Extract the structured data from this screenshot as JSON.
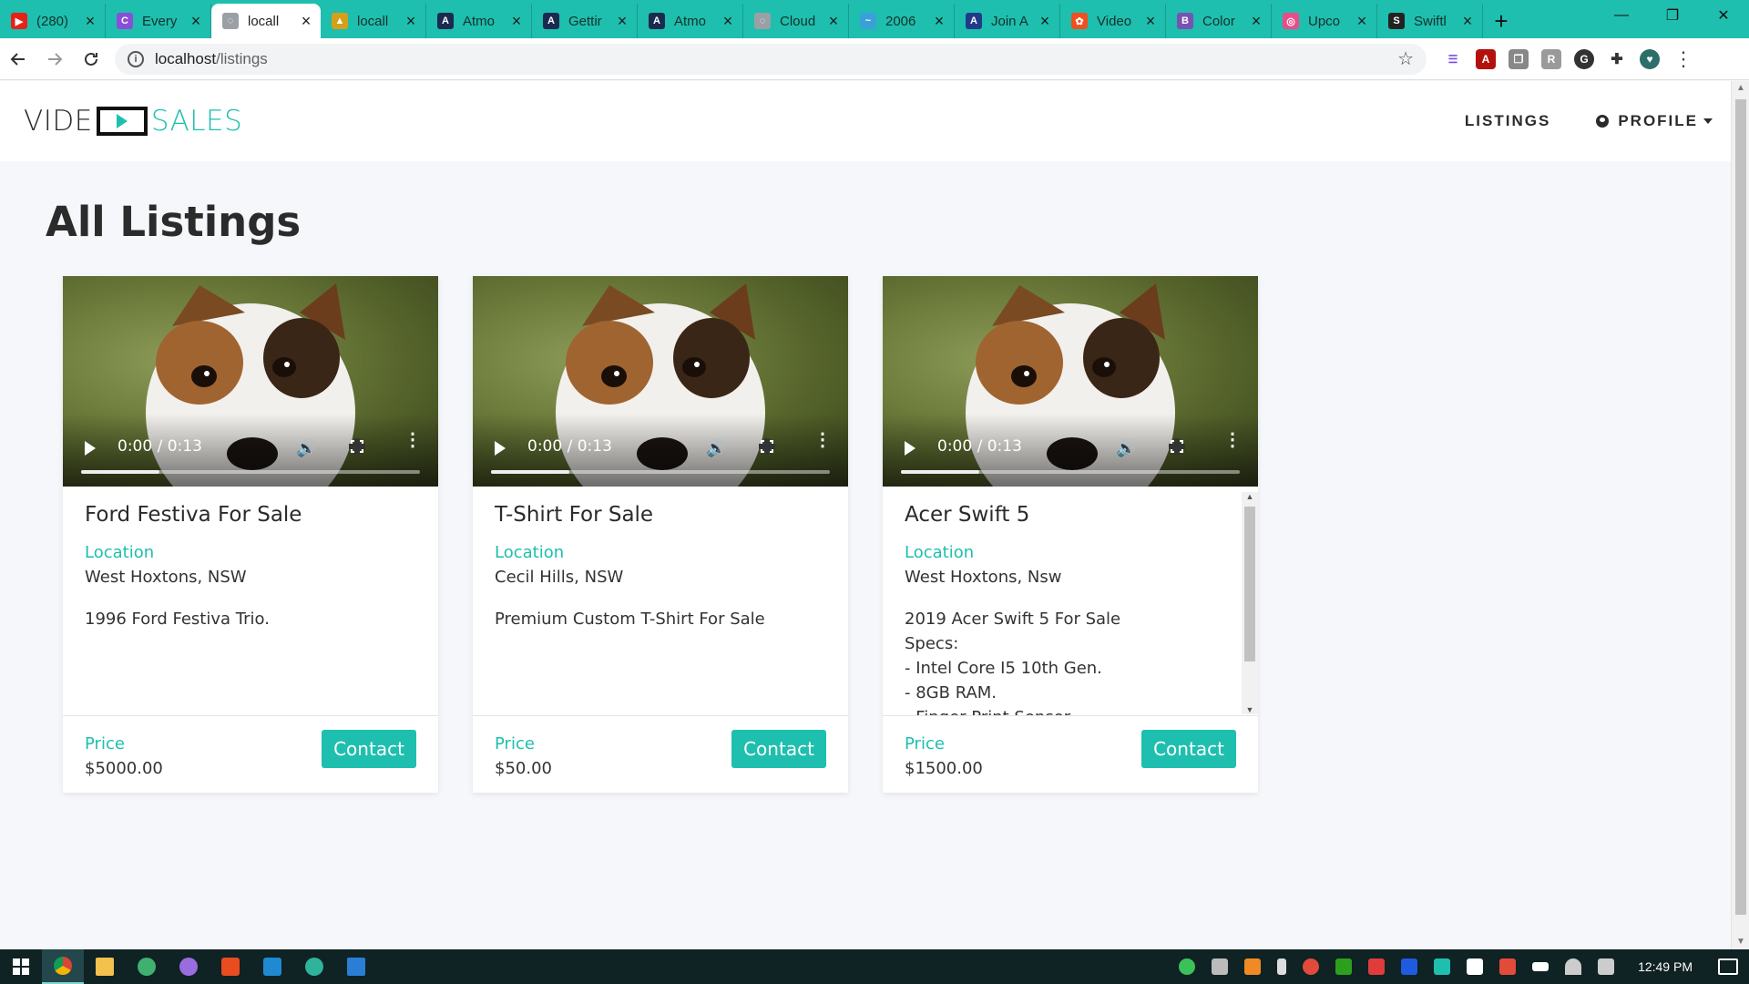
{
  "browser": {
    "tabs": [
      {
        "title": "(280)",
        "icon": "youtube-icon",
        "color": "#e62117",
        "glyph": "▶"
      },
      {
        "title": "Every",
        "icon": "purple-app-icon",
        "color": "#8a4fd8",
        "glyph": "C"
      },
      {
        "title": "locall",
        "icon": "globe-icon",
        "color": "#9aa0a6",
        "glyph": "◌",
        "active": true
      },
      {
        "title": "locall",
        "icon": "mountain-icon",
        "color": "#d4a017",
        "glyph": "▲"
      },
      {
        "title": "Atmo",
        "icon": "atmo-icon",
        "color": "#1a2a50",
        "glyph": "A"
      },
      {
        "title": "Gettir",
        "icon": "atmo-icon",
        "color": "#1a2a50",
        "glyph": "A"
      },
      {
        "title": "Atmo",
        "icon": "atmo-icon",
        "color": "#1a2a50",
        "glyph": "A"
      },
      {
        "title": "Cloud",
        "icon": "globe-icon",
        "color": "#9aa0a6",
        "glyph": "◌"
      },
      {
        "title": "2006",
        "icon": "wave-icon",
        "color": "#3aa0d8",
        "glyph": "~"
      },
      {
        "title": "Join A",
        "icon": "join-icon",
        "color": "#223a8c",
        "glyph": "A"
      },
      {
        "title": "Video",
        "icon": "figma-icon",
        "color": "#f24e1e",
        "glyph": "✿"
      },
      {
        "title": "Color",
        "icon": "bootstrap-icon",
        "color": "#7952b3",
        "glyph": "B"
      },
      {
        "title": "Upco",
        "icon": "dribbble-icon",
        "color": "#ea4c89",
        "glyph": "◎"
      },
      {
        "title": "Swiftl",
        "icon": "swift-icon",
        "color": "#222222",
        "glyph": "S"
      }
    ],
    "url_host": "localhost",
    "url_path": "/listings"
  },
  "navbar": {
    "logo_left": "VIDE",
    "logo_right": "SALES",
    "links": {
      "listings": "LISTINGS",
      "profile": "PROFILE"
    }
  },
  "page": {
    "heading": "All Listings"
  },
  "listings": [
    {
      "title": "Ford Festiva For Sale",
      "location_label": "Location",
      "location": "West Hoxtons, NSW",
      "description": "1996 Ford Festiva Trio.",
      "price_label": "Price",
      "price": "$5000.00",
      "contact_label": "Contact",
      "video_time": "0:00 / 0:13",
      "buffered": 0.23
    },
    {
      "title": "T-Shirt For Sale",
      "location_label": "Location",
      "location": "Cecil Hills, NSW",
      "description": "Premium Custom T-Shirt For Sale",
      "price_label": "Price",
      "price": "$50.00",
      "contact_label": "Contact",
      "video_time": "0:00 / 0:13",
      "buffered": 0.23
    },
    {
      "title": "Acer Swift 5",
      "location_label": "Location",
      "location": "West Hoxtons, Nsw",
      "description": "2019 Acer Swift 5 For Sale\nSpecs:\n- Intel Core I5 10th Gen.\n- 8GB RAM.\n- Finger Print Sensor",
      "price_label": "Price",
      "price": "$1500.00",
      "contact_label": "Contact",
      "video_time": "0:00 / 0:13",
      "buffered": 0.23
    }
  ],
  "taskbar": {
    "clock": "12:49 PM"
  },
  "colors": {
    "accent": "#1ebfae",
    "tabstrip": "#1ebfae",
    "taskbar": "#0f2224"
  }
}
